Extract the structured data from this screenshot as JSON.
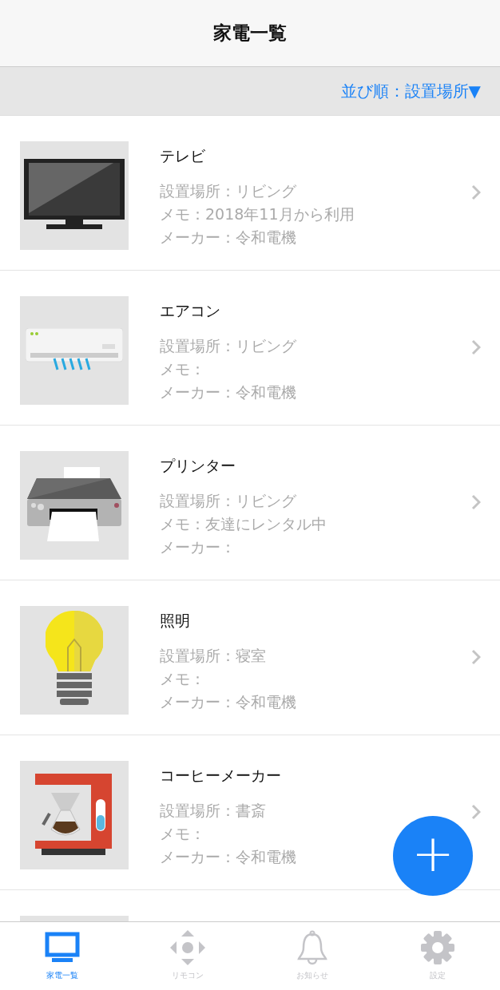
{
  "header": {
    "title": "家電一覧"
  },
  "sort": {
    "label": "並び順：設置場所▼"
  },
  "devices": [
    {
      "kind": "tv",
      "name": "テレビ",
      "location": "設置場所：リビング",
      "memo": "メモ：2018年11月から利用",
      "maker": "メーカー：令和電機"
    },
    {
      "kind": "aircon",
      "name": "エアコン",
      "location": "設置場所：リビング",
      "memo": "メモ：",
      "maker": "メーカー：令和電機"
    },
    {
      "kind": "printer",
      "name": "プリンター",
      "location": "設置場所：リビング",
      "memo": "メモ：友達にレンタル中",
      "maker": "メーカー："
    },
    {
      "kind": "light",
      "name": "照明",
      "location": "設置場所：寝室",
      "memo": "メモ：",
      "maker": "メーカー：令和電機"
    },
    {
      "kind": "coffee",
      "name": "コーヒーメーカー",
      "location": "設置場所：書斎",
      "memo": "メモ：",
      "maker": "メーカー：令和電機"
    },
    {
      "kind": "blank"
    }
  ],
  "add_button": {
    "label": "+"
  },
  "tabs": [
    {
      "kind": "list",
      "label": "家電一覧",
      "selected": true
    },
    {
      "kind": "remote",
      "label": "リモコン",
      "selected": false
    },
    {
      "kind": "notice",
      "label": "お知らせ",
      "selected": false
    },
    {
      "kind": "settings",
      "label": "設定",
      "selected": false
    }
  ]
}
